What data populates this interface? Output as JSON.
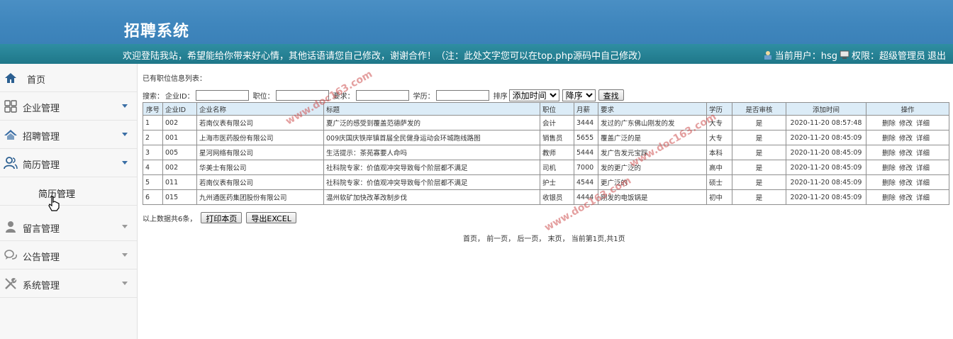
{
  "header": {
    "title": "招聘系统",
    "banner_text": "欢迎登陆我站，希望能给你带来好心情，其他话语请您自己修改，谢谢合作！（注：此处文字您可以在top.php源码中自己修改）",
    "current_user_label": "当前用户：hsg",
    "permission_label": "权限：超级管理员",
    "logout_label": "退出"
  },
  "sidebar": {
    "items": [
      {
        "label": "首页",
        "icon": "home-icon"
      },
      {
        "label": "企业管理",
        "icon": "grid-icon"
      },
      {
        "label": "招聘管理",
        "icon": "house-icon"
      },
      {
        "label": "简历管理",
        "icon": "people-icon"
      },
      {
        "label": "留言管理",
        "icon": "user-icon"
      },
      {
        "label": "公告管理",
        "icon": "chat-icon"
      },
      {
        "label": "系统管理",
        "icon": "tools-icon"
      }
    ],
    "sub_item": "简历管理"
  },
  "content": {
    "list_title": "已有职位信息列表：",
    "search": {
      "label": "搜索：",
      "company_id_label": "企业ID：",
      "position_label": "职位：",
      "requirement_label": "要求：",
      "education_label": "学历：",
      "sort_label": "排序",
      "sort_field_value": "添加时间",
      "sort_order_value": "降序",
      "search_button": "查找"
    },
    "table": {
      "columns": [
        "序号",
        "企业ID",
        "企业名称",
        "标题",
        "职位",
        "月薪",
        "要求",
        "学历",
        "是否审核",
        "添加时间",
        "操作"
      ],
      "rows": [
        [
          "1",
          "002",
          "若南仪表有限公司",
          "夏广泛的感受到覆盖范德萨发的",
          "会计",
          "3444",
          "发过的广东佛山刚发的发",
          "大专",
          "是",
          "2020-11-20 08:57:48"
        ],
        [
          "2",
          "001",
          "上海市医药股份有限公司",
          "009庆国庆铁岸镇首届全民健身运动会环城跑线路图",
          "销售员",
          "5655",
          "覆盖广泛的是",
          "大专",
          "是",
          "2020-11-20 08:45:09"
        ],
        [
          "3",
          "005",
          "星河网络有限公司",
          "生活提示：茶苑寡要人命吗",
          "教师",
          "5444",
          "发广告发元宝踩",
          "本科",
          "是",
          "2020-11-20 08:45:09"
        ],
        [
          "4",
          "002",
          "华美士有限公司",
          "社科院专家：价值观冲突导致每个阶层都不满足",
          "司机",
          "7000",
          "发的更广泛的",
          "高中",
          "是",
          "2020-11-20 08:45:09"
        ],
        [
          "5",
          "011",
          "若南仪表有限公司",
          "社科院专家：价值观冲突导致每个阶层都不满足",
          "护士",
          "4544",
          "更广泛的",
          "硕士",
          "是",
          "2020-11-20 08:45:09"
        ],
        [
          "6",
          "015",
          "九州通医药集团股份有限公司",
          "温州软矿加快改革改制步伐",
          "收银员",
          "4444",
          "刚发的电饭锅是",
          "初中",
          "是",
          "2020-11-20 08:45:09"
        ]
      ],
      "ops": [
        "删除",
        "修改",
        "详细"
      ]
    },
    "total_text": "以上数据共6条，",
    "print_button": "打印本页",
    "export_button": "导出EXCEL",
    "pager": {
      "first": "首页",
      "prev": "前一页",
      "next": "后一页",
      "last": "末页",
      "status": "当前第1页,共1页"
    }
  },
  "watermark": "www.doc163.com"
}
